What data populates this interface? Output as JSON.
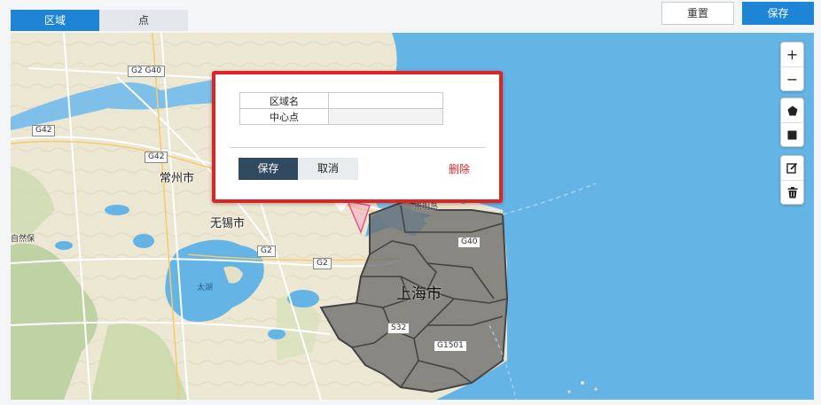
{
  "tabs": [
    {
      "label": "区域",
      "active": true
    },
    {
      "label": "点",
      "active": false
    }
  ],
  "toolbar": {
    "reset_label": "重置",
    "save_label": "保存"
  },
  "colors": {
    "accent": "#1d84d6",
    "sea": "#65b4e6",
    "land": "#ece7d2",
    "region_fill": "#6b6b6b",
    "popup_border": "#e02424",
    "delete_text": "#d9262a"
  },
  "popup": {
    "fields": [
      {
        "label": "区域名",
        "value": ""
      },
      {
        "label": "中心点",
        "value": ""
      }
    ],
    "save_label": "保存",
    "cancel_label": "取消",
    "delete_label": "删除"
  },
  "map": {
    "cities": {
      "changzhou": "常州市",
      "wuxi": "无锡市",
      "shanghai": "上海市"
    },
    "water": {
      "taihu": "太湖"
    },
    "places": {
      "chongming": "崇明岛",
      "left_edge": "自然保"
    },
    "road_shields": [
      "G2 G40",
      "G42",
      "G42",
      "G2",
      "G2",
      "G40",
      "S32",
      "G1501"
    ],
    "controls": {
      "zoom_in": "+",
      "zoom_out": "−"
    }
  },
  "icons": {
    "zoom_in": "plus-icon",
    "zoom_out": "minus-icon",
    "polygon": "pentagon-icon",
    "rectangle": "square-icon",
    "edit": "edit-icon",
    "delete": "trash-icon"
  }
}
